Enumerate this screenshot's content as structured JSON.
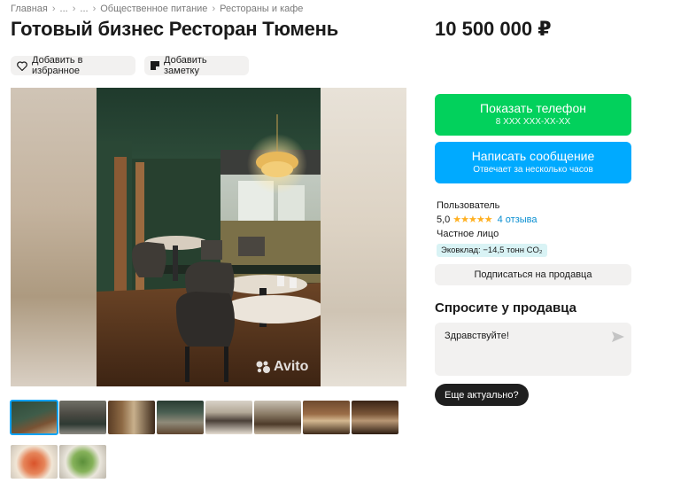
{
  "breadcrumb": {
    "items": [
      "Главная",
      "...",
      "...",
      "Общественное питание",
      "Рестораны и кафе"
    ],
    "separator": "›"
  },
  "listing": {
    "title": "Готовый бизнес Ресторан Тюмень",
    "price": "10 500 000 ₽"
  },
  "actions": {
    "favorite_label": "Добавить в избранное",
    "note_label": "Добавить заметку"
  },
  "gallery": {
    "watermark": "Avito",
    "thumbnail_count": 10,
    "active_index": 0
  },
  "contact": {
    "phone_label": "Показать телефон",
    "phone_masked": "8 XXX XXX-XX-XX",
    "message_label": "Написать сообщение",
    "message_sub": "Отвечает за несколько часов",
    "phone_color": "#02d15c",
    "message_color": "#00aaff"
  },
  "seller": {
    "name": "Пользователь",
    "rating": "5,0",
    "stars": "★★★★★",
    "reviews": "4 отзыва",
    "type": "Частное лицо",
    "eco": "Эковклад: −14,5 тонн CO₂",
    "subscribe_label": "Подписаться на продавца"
  },
  "ask": {
    "title": "Спросите у продавца",
    "message": "Здравствуйте!",
    "quick_reply": "Еще актуально?"
  }
}
